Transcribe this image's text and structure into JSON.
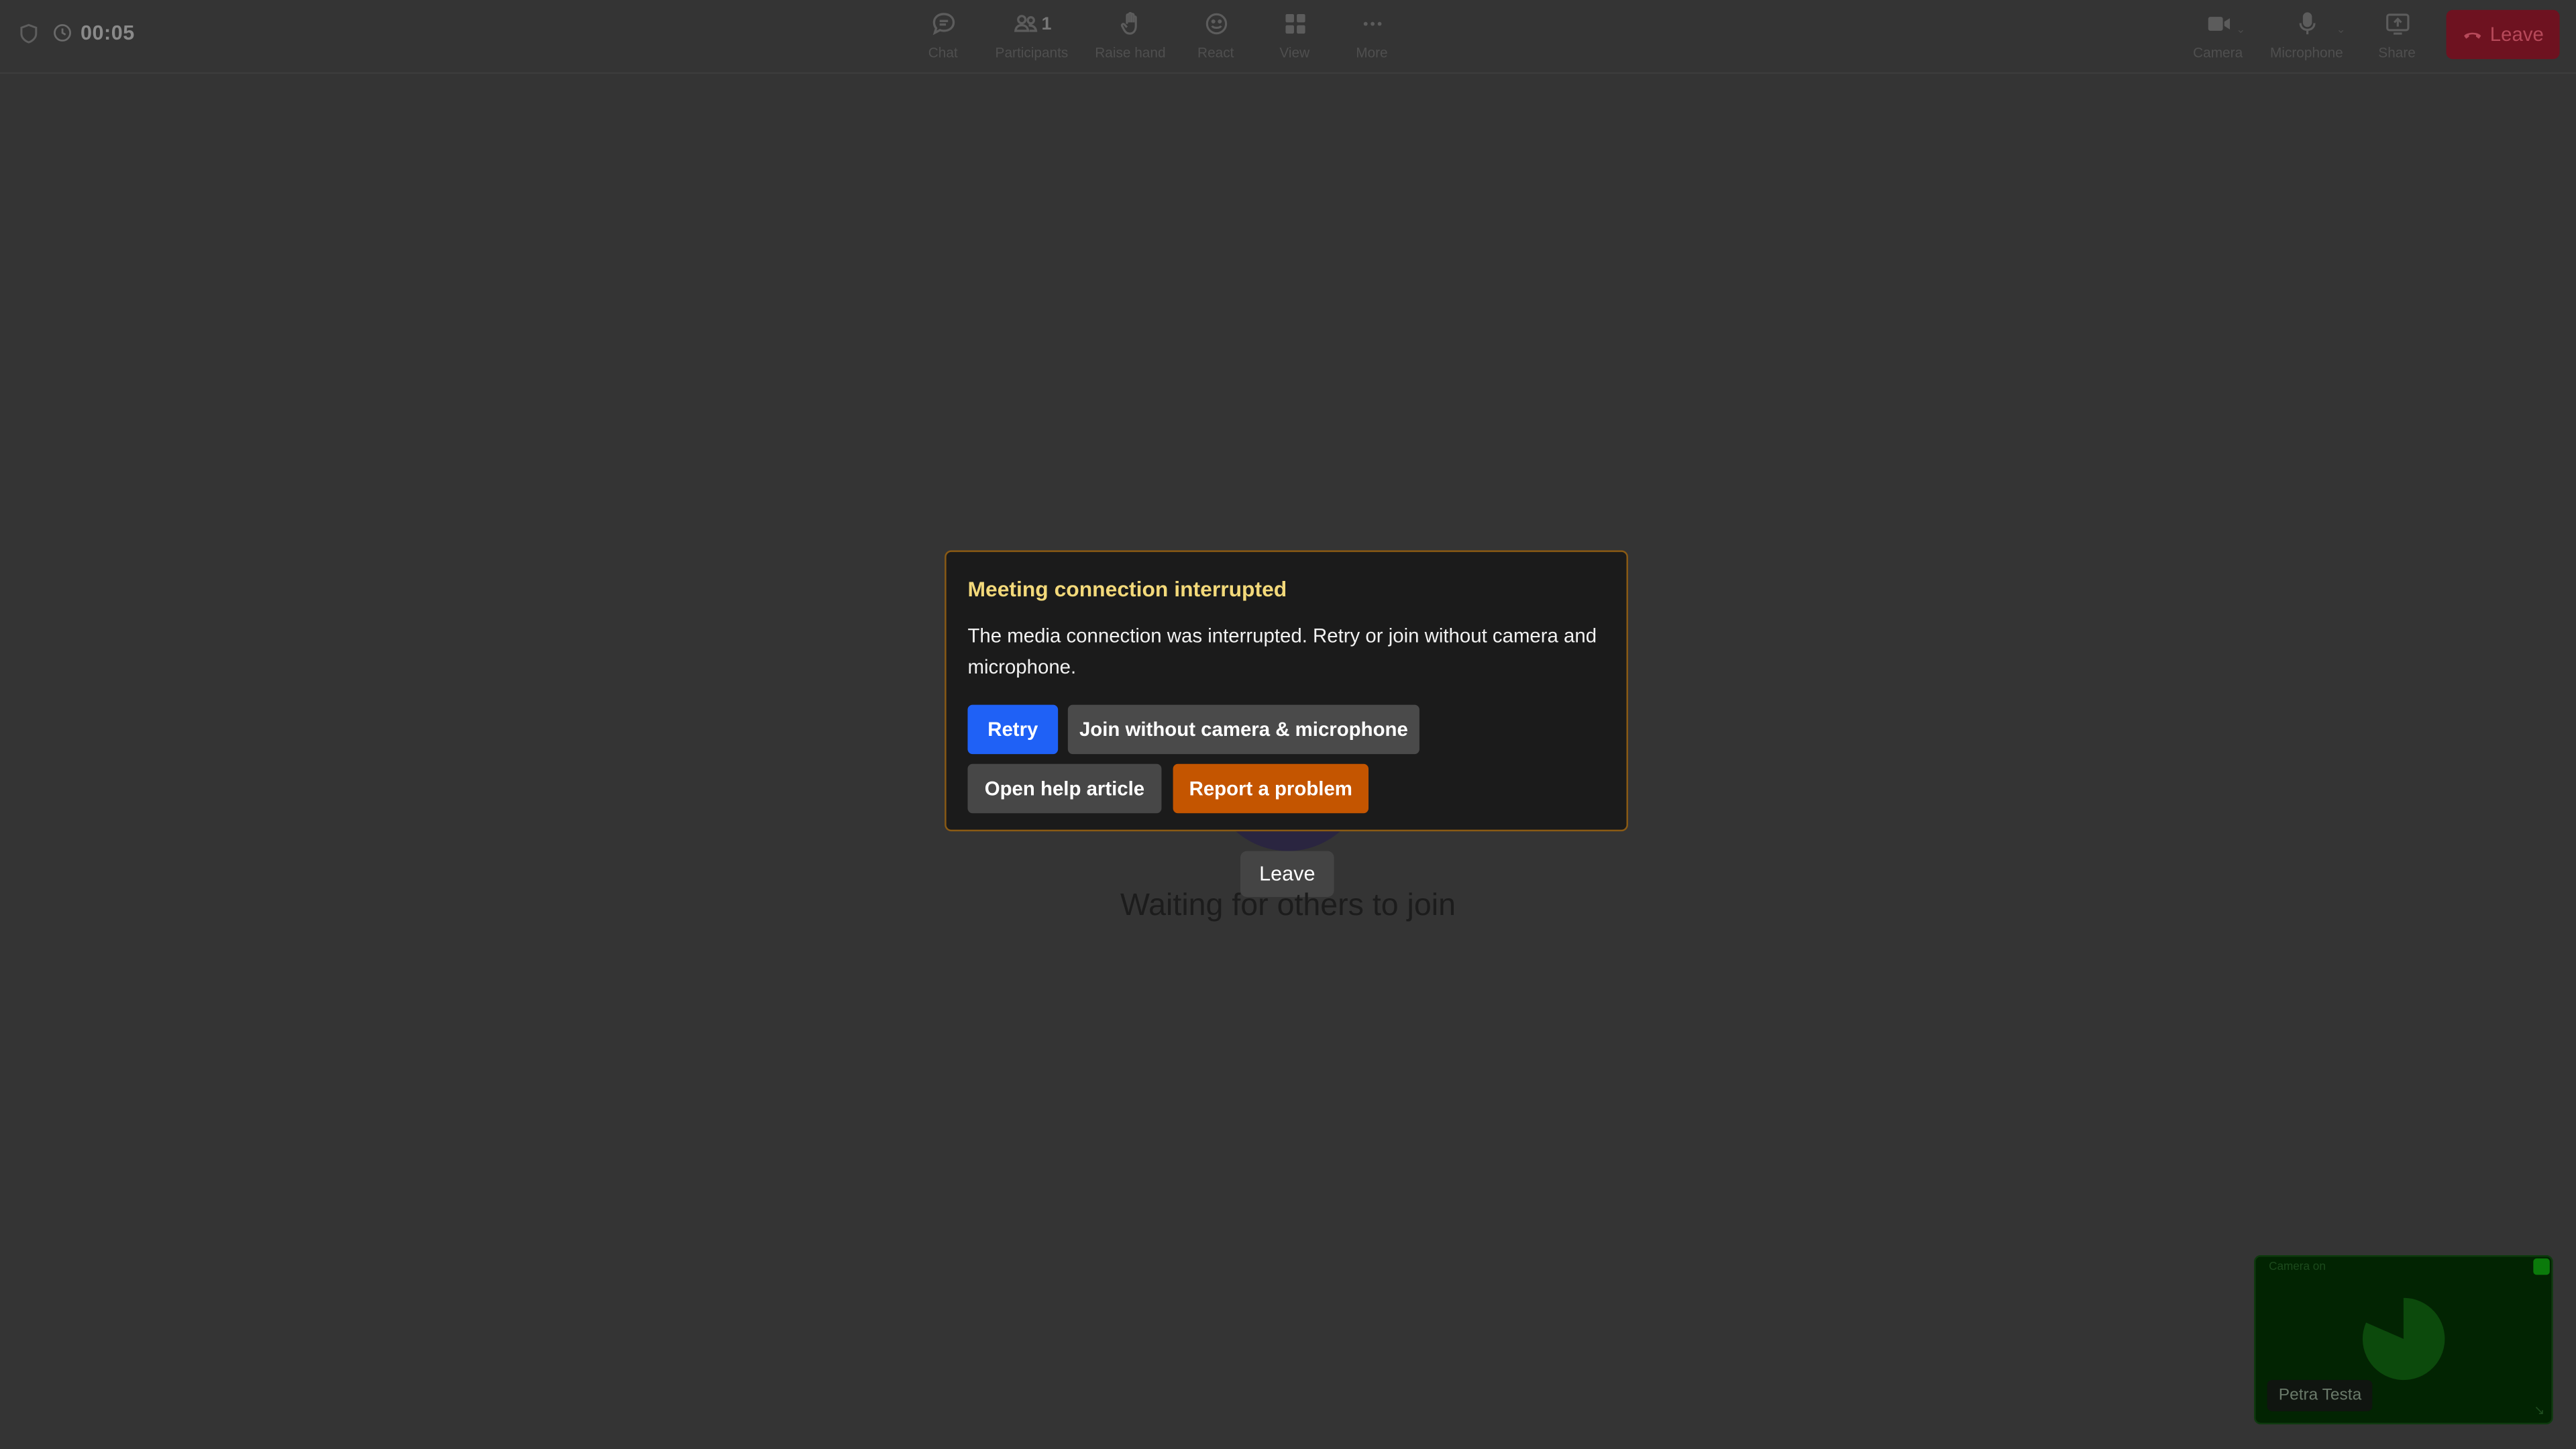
{
  "header": {
    "timer": "00:05",
    "toolbar_center": [
      {
        "id": "chat",
        "label": "Chat",
        "icon": "chat-bubble-icon"
      },
      {
        "id": "participants",
        "label": "Participants",
        "icon": "people-icon",
        "count": "1"
      },
      {
        "id": "raise-hand",
        "label": "Raise hand",
        "icon": "hand-icon"
      },
      {
        "id": "react",
        "label": "React",
        "icon": "smiley-icon"
      },
      {
        "id": "view",
        "label": "View",
        "icon": "grid-icon"
      },
      {
        "id": "more",
        "label": "More",
        "icon": "ellipsis-icon"
      }
    ],
    "toolbar_right": [
      {
        "id": "camera",
        "label": "Camera",
        "icon": "video-camera-icon"
      },
      {
        "id": "microphone",
        "label": "Microphone",
        "icon": "microphone-icon"
      },
      {
        "id": "share",
        "label": "Share",
        "icon": "share-screen-icon"
      }
    ],
    "leave_label": "Leave"
  },
  "stage": {
    "leave_tooltip": "Leave",
    "waiting_text": "Waiting for others to join"
  },
  "dialog": {
    "title": "Meeting connection interrupted",
    "body": "The media connection was interrupted. Retry or join without camera and microphone.",
    "retry_label": "Retry",
    "join_label": "Join without camera & microphone",
    "help_label": "Open help article",
    "report_label": "Report a problem"
  },
  "self_view": {
    "tag": "Camera on",
    "name": "Petra Testa"
  },
  "colors": {
    "background": "#343434",
    "dialog_border": "#8a5a14",
    "dialog_title": "#f3d97a",
    "retry": "#1f61f6",
    "report": "#c45500",
    "leave": "#6e1220",
    "self_view": "#022402"
  }
}
